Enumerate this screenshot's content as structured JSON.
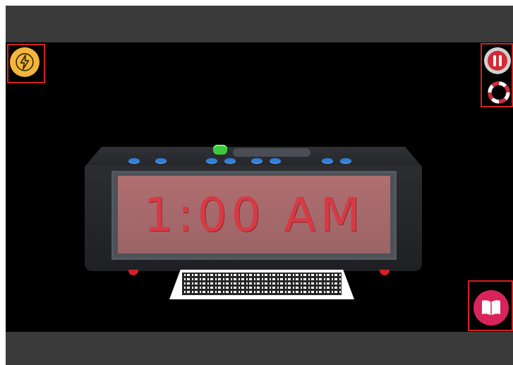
{
  "clock": {
    "display_time": "1:00 AM"
  },
  "icons": {
    "power": "lightning-icon",
    "pause": "pause-icon",
    "help": "lifebuoy-icon",
    "guide": "book-icon"
  },
  "colors": {
    "power_button": "#f3b53b",
    "book_button": "#d8245a",
    "highlight_box": "#d42020",
    "display_digits": "#d83a44"
  }
}
